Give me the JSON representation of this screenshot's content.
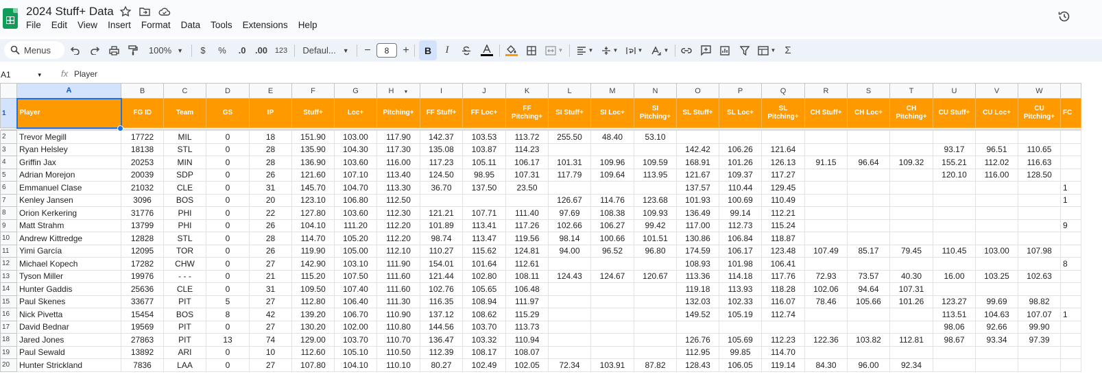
{
  "app": {
    "doc_title": "2024 Stuff+ Data",
    "menus": [
      "File",
      "Edit",
      "View",
      "Insert",
      "Format",
      "Data",
      "Tools",
      "Extensions",
      "Help"
    ]
  },
  "toolbar": {
    "search_label": "Menus",
    "zoom": "100%",
    "currency": "$",
    "percent": "%",
    "dec_decrease": ".0",
    "dec_increase": ".00",
    "number_format": "123",
    "font": "Defaul...",
    "font_size": "8",
    "minus": "−",
    "plus": "+",
    "bold": "B",
    "italic": "I"
  },
  "formula_bar": {
    "cell_ref": "A1",
    "fx": "fx",
    "value": "Player"
  },
  "sheet": {
    "columns": [
      "A",
      "B",
      "C",
      "D",
      "E",
      "F",
      "G",
      "H",
      "I",
      "J",
      "K",
      "L",
      "M",
      "N",
      "O",
      "P",
      "Q",
      "R",
      "S",
      "T",
      "U",
      "V",
      "W"
    ],
    "headers": [
      "Player",
      "FG ID",
      "Team",
      "GS",
      "IP",
      "Stuff+",
      "Loc+",
      "Pitching+",
      "FF Stuff+",
      "FF Loc+",
      "FF Pitching+",
      "SI Stuff+",
      "SI Loc+",
      "SI Pitching+",
      "SL Stuff+",
      "SL Loc+",
      "SL Pitching+",
      "CH Stuff+",
      "CH Loc+",
      "CH Pitching+",
      "CU Stuff+",
      "CU Loc+",
      "CU Pitching+"
    ],
    "overflow_header": "FC",
    "rows": [
      {
        "num": "2",
        "cells": [
          "Trevor Megill",
          "17722",
          "MIL",
          "0",
          "18",
          "151.90",
          "103.00",
          "117.90",
          "142.37",
          "103.53",
          "113.72",
          "255.50",
          "48.40",
          "53.10",
          "",
          "",
          "",
          "",
          "",
          "",
          "",
          "",
          ""
        ],
        "edge": ""
      },
      {
        "num": "3",
        "cells": [
          "Ryan Helsley",
          "18138",
          "STL",
          "0",
          "28",
          "135.90",
          "104.30",
          "117.30",
          "135.08",
          "103.87",
          "114.23",
          "",
          "",
          "",
          "142.42",
          "106.26",
          "121.64",
          "",
          "",
          "",
          "93.17",
          "96.51",
          "110.65"
        ],
        "edge": ""
      },
      {
        "num": "4",
        "cells": [
          "Griffin Jax",
          "20253",
          "MIN",
          "0",
          "28",
          "136.90",
          "103.60",
          "116.00",
          "117.23",
          "105.11",
          "106.17",
          "101.31",
          "109.96",
          "109.59",
          "168.91",
          "101.26",
          "126.13",
          "91.15",
          "96.64",
          "109.32",
          "155.21",
          "112.02",
          "116.63"
        ],
        "edge": ""
      },
      {
        "num": "5",
        "cells": [
          "Adrian Morejon",
          "20039",
          "SDP",
          "0",
          "26",
          "121.60",
          "107.10",
          "113.40",
          "124.50",
          "98.95",
          "107.31",
          "117.79",
          "109.64",
          "113.95",
          "121.67",
          "109.37",
          "117.27",
          "",
          "",
          "",
          "120.10",
          "116.00",
          "128.50"
        ],
        "edge": ""
      },
      {
        "num": "6",
        "cells": [
          "Emmanuel Clase",
          "21032",
          "CLE",
          "0",
          "31",
          "145.70",
          "104.70",
          "113.30",
          "36.70",
          "137.50",
          "23.50",
          "",
          "",
          "",
          "137.57",
          "110.44",
          "129.45",
          "",
          "",
          "",
          "",
          "",
          ""
        ],
        "edge": "1"
      },
      {
        "num": "7",
        "cells": [
          "Kenley Jansen",
          "3096",
          "BOS",
          "0",
          "20",
          "123.10",
          "106.80",
          "112.50",
          "",
          "",
          "",
          "126.67",
          "114.76",
          "123.68",
          "101.93",
          "100.69",
          "110.49",
          "",
          "",
          "",
          "",
          "",
          ""
        ],
        "edge": "1"
      },
      {
        "num": "8",
        "cells": [
          "Orion Kerkering",
          "31776",
          "PHI",
          "0",
          "22",
          "127.80",
          "103.60",
          "112.30",
          "121.21",
          "107.71",
          "111.40",
          "97.69",
          "108.38",
          "109.93",
          "136.49",
          "99.14",
          "112.21",
          "",
          "",
          "",
          "",
          "",
          ""
        ],
        "edge": ""
      },
      {
        "num": "9",
        "cells": [
          "Matt Strahm",
          "13799",
          "PHI",
          "0",
          "26",
          "104.10",
          "111.20",
          "112.20",
          "101.89",
          "113.41",
          "117.26",
          "102.66",
          "106.27",
          "99.42",
          "117.00",
          "112.73",
          "115.24",
          "",
          "",
          "",
          "",
          "",
          ""
        ],
        "edge": "9"
      },
      {
        "num": "10",
        "cells": [
          "Andrew Kittredge",
          "12828",
          "STL",
          "0",
          "28",
          "114.70",
          "105.20",
          "112.20",
          "98.74",
          "113.47",
          "119.56",
          "98.14",
          "100.66",
          "101.51",
          "130.86",
          "106.84",
          "118.87",
          "",
          "",
          "",
          "",
          "",
          ""
        ],
        "edge": ""
      },
      {
        "num": "11",
        "cells": [
          "Yimi García",
          "12095",
          "TOR",
          "0",
          "26",
          "119.90",
          "105.00",
          "112.10",
          "110.27",
          "115.62",
          "124.81",
          "94.00",
          "96.52",
          "96.80",
          "174.59",
          "106.17",
          "123.48",
          "107.49",
          "85.17",
          "79.45",
          "110.45",
          "103.00",
          "107.98"
        ],
        "edge": ""
      },
      {
        "num": "12",
        "cells": [
          "Michael Kopech",
          "17282",
          "CHW",
          "0",
          "27",
          "142.90",
          "103.10",
          "111.90",
          "154.01",
          "101.64",
          "112.61",
          "",
          "",
          "",
          "108.93",
          "101.98",
          "106.41",
          "",
          "",
          "",
          "",
          "",
          ""
        ],
        "edge": "8"
      },
      {
        "num": "13",
        "cells": [
          "Tyson Miller",
          "19976",
          "- - -",
          "0",
          "21",
          "115.20",
          "107.50",
          "111.60",
          "121.44",
          "102.80",
          "108.11",
          "124.43",
          "124.67",
          "120.67",
          "113.36",
          "114.18",
          "117.76",
          "72.93",
          "73.57",
          "40.30",
          "16.00",
          "103.25",
          "102.63"
        ],
        "edge": ""
      },
      {
        "num": "14",
        "cells": [
          "Hunter Gaddis",
          "25636",
          "CLE",
          "0",
          "31",
          "109.50",
          "107.40",
          "111.60",
          "102.76",
          "105.65",
          "106.48",
          "",
          "",
          "",
          "119.18",
          "113.93",
          "118.28",
          "102.06",
          "94.64",
          "107.31",
          "",
          "",
          ""
        ],
        "edge": ""
      },
      {
        "num": "15",
        "cells": [
          "Paul Skenes",
          "33677",
          "PIT",
          "5",
          "27",
          "112.80",
          "106.40",
          "111.30",
          "116.35",
          "108.94",
          "111.97",
          "",
          "",
          "",
          "132.03",
          "102.33",
          "116.07",
          "78.46",
          "105.66",
          "101.26",
          "123.27",
          "99.69",
          "98.82"
        ],
        "edge": ""
      },
      {
        "num": "16",
        "cells": [
          "Nick Pivetta",
          "15454",
          "BOS",
          "8",
          "42",
          "139.20",
          "106.70",
          "110.90",
          "137.12",
          "108.62",
          "115.29",
          "",
          "",
          "",
          "149.52",
          "105.19",
          "112.74",
          "",
          "",
          "",
          "113.51",
          "104.63",
          "107.07"
        ],
        "edge": "1"
      },
      {
        "num": "17",
        "cells": [
          "David Bednar",
          "19569",
          "PIT",
          "0",
          "27",
          "130.20",
          "102.00",
          "110.80",
          "144.56",
          "103.70",
          "113.73",
          "",
          "",
          "",
          "",
          "",
          "",
          "",
          "",
          "",
          "98.06",
          "92.66",
          "99.90"
        ],
        "edge": ""
      },
      {
        "num": "18",
        "cells": [
          "Jared Jones",
          "27863",
          "PIT",
          "13",
          "74",
          "129.00",
          "103.70",
          "110.70",
          "136.47",
          "103.32",
          "110.94",
          "",
          "",
          "",
          "126.76",
          "105.69",
          "112.23",
          "122.36",
          "103.82",
          "112.81",
          "98.67",
          "93.34",
          "97.39"
        ],
        "edge": ""
      },
      {
        "num": "19",
        "cells": [
          "Paul Sewald",
          "13892",
          "ARI",
          "0",
          "10",
          "112.60",
          "105.10",
          "110.50",
          "112.39",
          "108.17",
          "108.07",
          "",
          "",
          "",
          "112.95",
          "99.85",
          "114.70",
          "",
          "",
          "",
          "",
          "",
          ""
        ],
        "edge": ""
      },
      {
        "num": "20",
        "cells": [
          "Hunter Strickland",
          "7836",
          "LAA",
          "0",
          "27",
          "107.80",
          "104.10",
          "110.10",
          "80.27",
          "102.49",
          "102.05",
          "72.34",
          "103.91",
          "87.82",
          "128.43",
          "106.05",
          "119.14",
          "84.30",
          "96.00",
          "92.34",
          "",
          "",
          ""
        ],
        "edge": ""
      }
    ]
  }
}
